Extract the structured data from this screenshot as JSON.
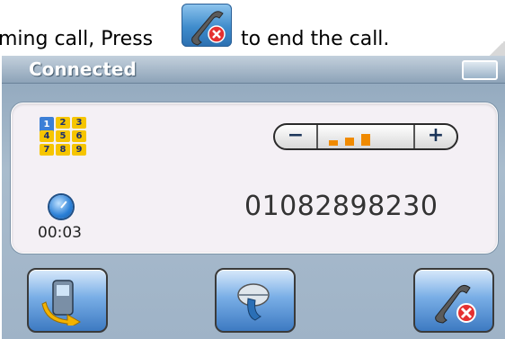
{
  "instruction": {
    "text_before": "ming call, Press",
    "text_after": "to end the call.",
    "icon": "end-call-icon"
  },
  "window": {
    "title": "Connected",
    "title_button_icon": "switch-window-icon"
  },
  "call": {
    "number": "01082898230",
    "duration": "00:03",
    "keypad_icon": "keypad-icon",
    "timer_icon": "clock-icon",
    "keypad_keys": [
      "1",
      "2",
      "3",
      "4",
      "5",
      "6",
      "7",
      "8",
      "9"
    ]
  },
  "volume": {
    "minus_label": "−",
    "plus_label": "+",
    "level_bars": 3
  },
  "buttons": {
    "transfer_icon": "phone-transfer-icon",
    "mute_icon": "mute-icon",
    "end_call_icon": "end-call-icon"
  },
  "colors": {
    "accent": "#f08a00",
    "end_red": "#e53030",
    "button_blue": "#79aee6"
  }
}
